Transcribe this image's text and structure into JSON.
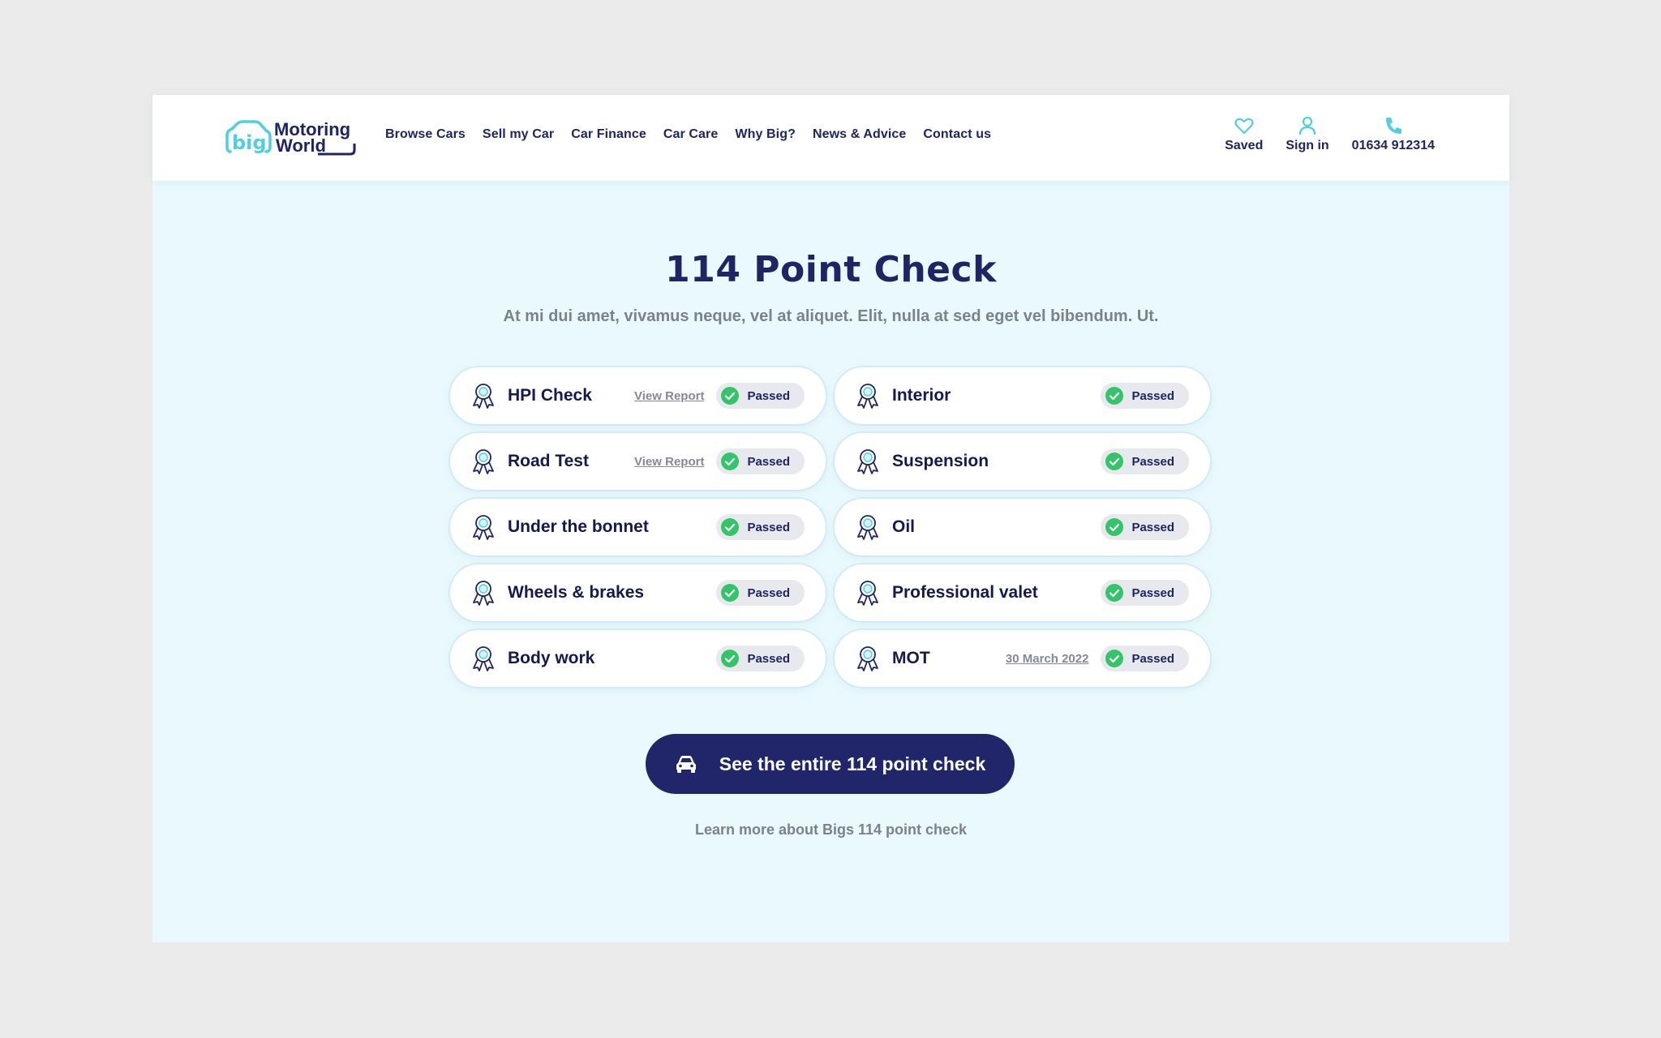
{
  "brand": {
    "mark_text": "big",
    "name_line1": "Motoring",
    "name_line2": "World",
    "accent": "#4fcfe0",
    "navy": "#1f2463"
  },
  "nav": [
    {
      "label": "Browse Cars"
    },
    {
      "label": "Sell my Car"
    },
    {
      "label": "Car Finance"
    },
    {
      "label": "Car Care"
    },
    {
      "label": "Why Big?"
    },
    {
      "label": "News & Advice"
    },
    {
      "label": "Contact us"
    }
  ],
  "utility": {
    "saved": {
      "label": "Saved",
      "icon": "heart-icon"
    },
    "signin": {
      "label": "Sign in",
      "icon": "user-icon"
    },
    "phone": {
      "label": "01634 912314",
      "icon": "phone-icon"
    }
  },
  "hero": {
    "title": "114 Point Check",
    "subtitle": "At mi dui amet, vivamus neque, vel at aliquet. Elit, nulla at sed eget vel bibendum. Ut."
  },
  "checks": [
    {
      "label": "HPI Check",
      "link": "View Report",
      "status": "Passed"
    },
    {
      "label": "Interior",
      "status": "Passed"
    },
    {
      "label": "Road Test",
      "link": "View Report",
      "status": "Passed"
    },
    {
      "label": "Suspension",
      "status": "Passed"
    },
    {
      "label": "Under the bonnet",
      "status": "Passed"
    },
    {
      "label": "Oil",
      "status": "Passed"
    },
    {
      "label": "Wheels & brakes",
      "status": "Passed"
    },
    {
      "label": "Professional valet",
      "status": "Passed"
    },
    {
      "label": "Body work",
      "status": "Passed"
    },
    {
      "label": "MOT",
      "date": "30 March 2022",
      "status": "Passed"
    }
  ],
  "cta": {
    "label": "See the entire 114 point check",
    "icon": "car-icon"
  },
  "learn_more": "Learn more about Bigs 114 point check",
  "colors": {
    "pass_green": "#36c46b",
    "pill_bg": "#e7e9ee",
    "page_bg": "#e9f9fd"
  }
}
